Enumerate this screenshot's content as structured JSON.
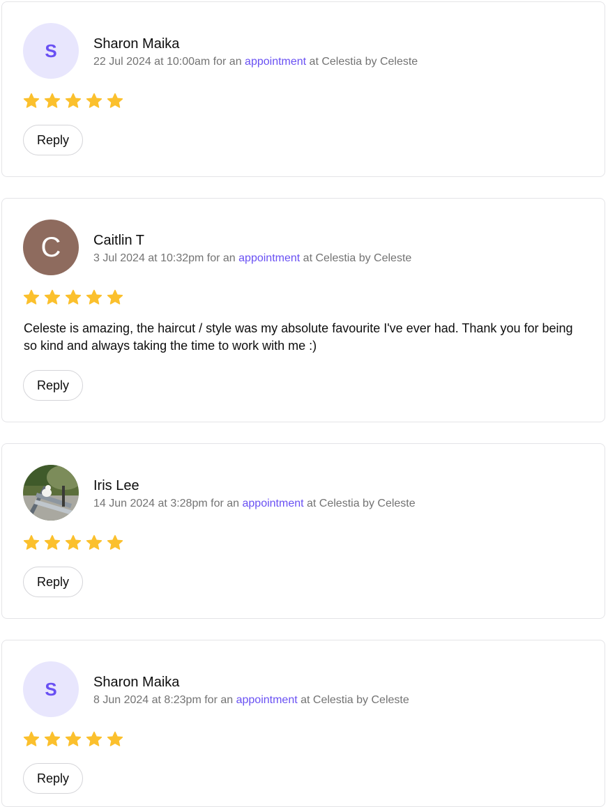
{
  "reviews": [
    {
      "name": "Sharon Maika",
      "date": "22 Jul 2024 at 10:00am",
      "meta_for": " for an ",
      "link": "appointment",
      "meta_at": " at Celestia by Celeste",
      "avatar_letter": "S",
      "rating": 5,
      "comment": "",
      "reply_label": "Reply"
    },
    {
      "name": "Caitlin T",
      "date": "3 Jul 2024 at 10:32pm",
      "meta_for": " for an ",
      "link": "appointment",
      "meta_at": " at Celestia by Celeste",
      "avatar_letter": "C",
      "rating": 5,
      "comment": "Celeste is amazing, the haircut / style was my absolute favourite I've ever had. Thank you for being so kind and always taking the time to work with me :)",
      "reply_label": "Reply"
    },
    {
      "name": "Iris Lee",
      "date": "14 Jun 2024 at 3:28pm",
      "meta_for": " for an ",
      "link": "appointment",
      "meta_at": " at Celestia by Celeste",
      "avatar_letter": "",
      "rating": 5,
      "comment": "",
      "reply_label": "Reply"
    },
    {
      "name": "Sharon Maika",
      "date": "8 Jun 2024 at 8:23pm",
      "meta_for": " for an ",
      "link": "appointment",
      "meta_at": " at Celestia by Celeste",
      "avatar_letter": "S",
      "rating": 5,
      "comment": "",
      "reply_label": "Reply"
    }
  ],
  "colors": {
    "accent": "#6950f3",
    "star": "#fbc02d",
    "avatar_light_bg": "#e8e6fd",
    "avatar_brown_bg": "#8e6b5e",
    "border": "#e4e4e7",
    "muted_text": "#737373"
  },
  "icons": {
    "rating_star": "star-icon",
    "photo_avatar": "user-photo-avatar"
  }
}
